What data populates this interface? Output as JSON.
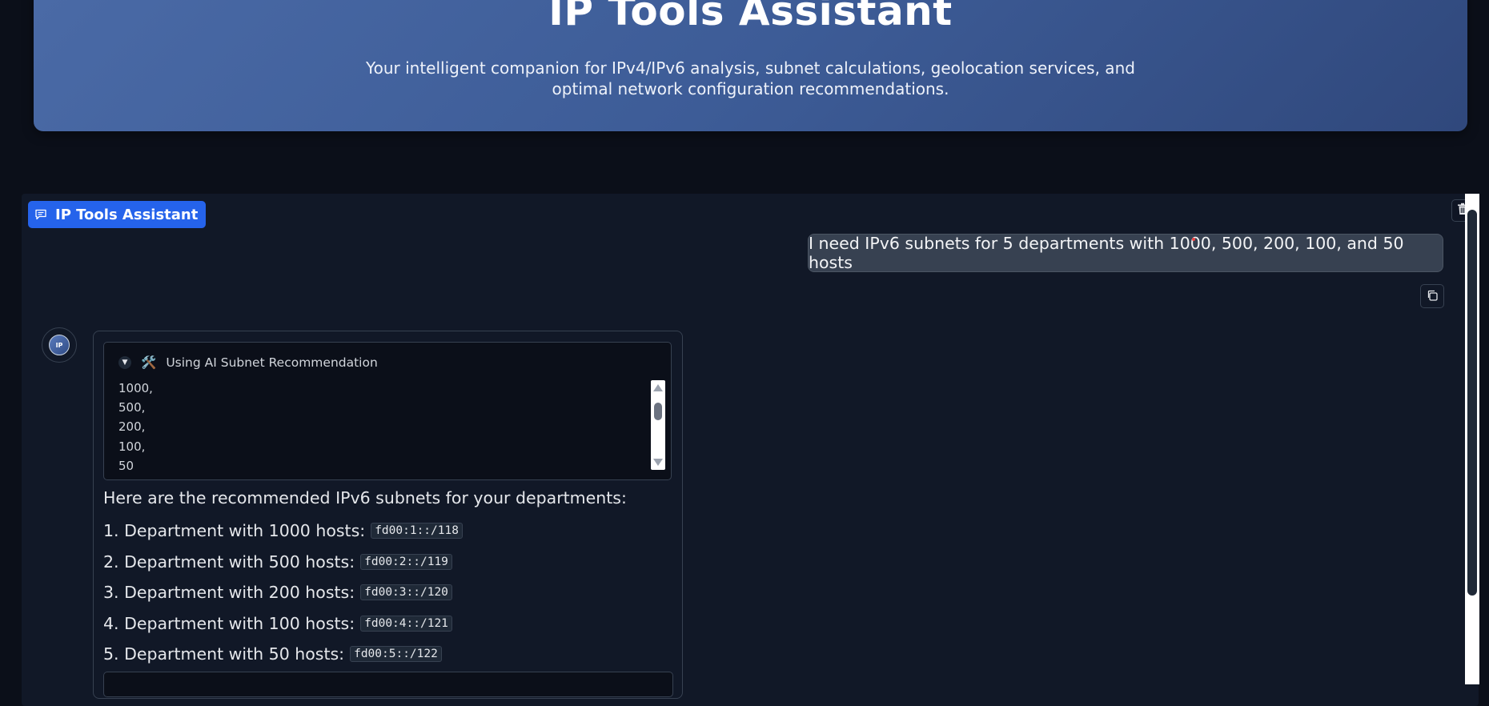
{
  "hero": {
    "title": "IP Tools Assistant",
    "subtitle": "Your intelligent companion for IPv4/IPv6 analysis, subnet calculations, geolocation services, and optimal network configuration recommendations."
  },
  "chat": {
    "badge_label": "IP Tools Assistant",
    "user_message": "I need IPv6 subnets for 5 departments with 1000, 500, 200, 100, and 50 hosts",
    "avatar_text": "IP",
    "tool_call": {
      "emoji": "🛠️",
      "label": "Using AI Subnet Recommendation",
      "lines": [
        "1000,",
        "500,",
        "200,",
        "100,",
        "50"
      ]
    },
    "answer_intro": "Here are the recommended IPv6 subnets for your departments:",
    "answers": [
      {
        "text": "1. Department with 1000 hosts:",
        "subnet": "fd00:1::/118"
      },
      {
        "text": "2. Department with 500 hosts:",
        "subnet": "fd00:2::/119"
      },
      {
        "text": "3. Department with 200 hosts:",
        "subnet": "fd00:3::/120"
      },
      {
        "text": "4. Department with 100 hosts:",
        "subnet": "fd00:4::/121"
      },
      {
        "text": "5. Department with 50 hosts:",
        "subnet": "fd00:5::/122"
      }
    ]
  },
  "colors": {
    "background": "#0b0f19",
    "panel": "#111827",
    "accent": "#2563eb",
    "hero_gradient_start": "#4a6aa6",
    "hero_gradient_end": "#30487c"
  }
}
